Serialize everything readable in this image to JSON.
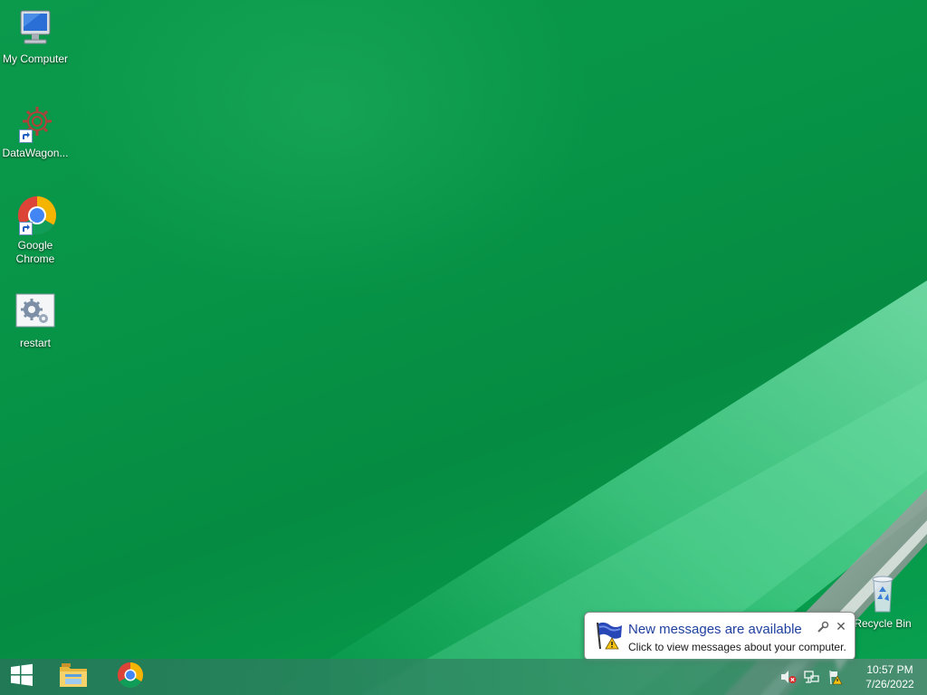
{
  "desktop": {
    "icons": [
      {
        "label": "My Computer"
      },
      {
        "label": "DataWagon..."
      },
      {
        "label": "Google\nChrome"
      },
      {
        "label": "restart"
      },
      {
        "label": "Recycle Bin"
      }
    ]
  },
  "taskbar": {
    "pinned": [
      "windows-start-icon",
      "file-explorer-icon",
      "chrome-icon"
    ],
    "tray_icons": [
      "volume-muted-icon",
      "network-icon",
      "action-center-warning-icon"
    ],
    "clock": {
      "time": "10:57 PM",
      "date": "7/26/2022"
    }
  },
  "notification": {
    "title": "New messages are available",
    "text": "Click to view messages about your computer."
  },
  "colors": {
    "wallpaper": "#079447",
    "balloon_title": "#1e3f9e"
  }
}
